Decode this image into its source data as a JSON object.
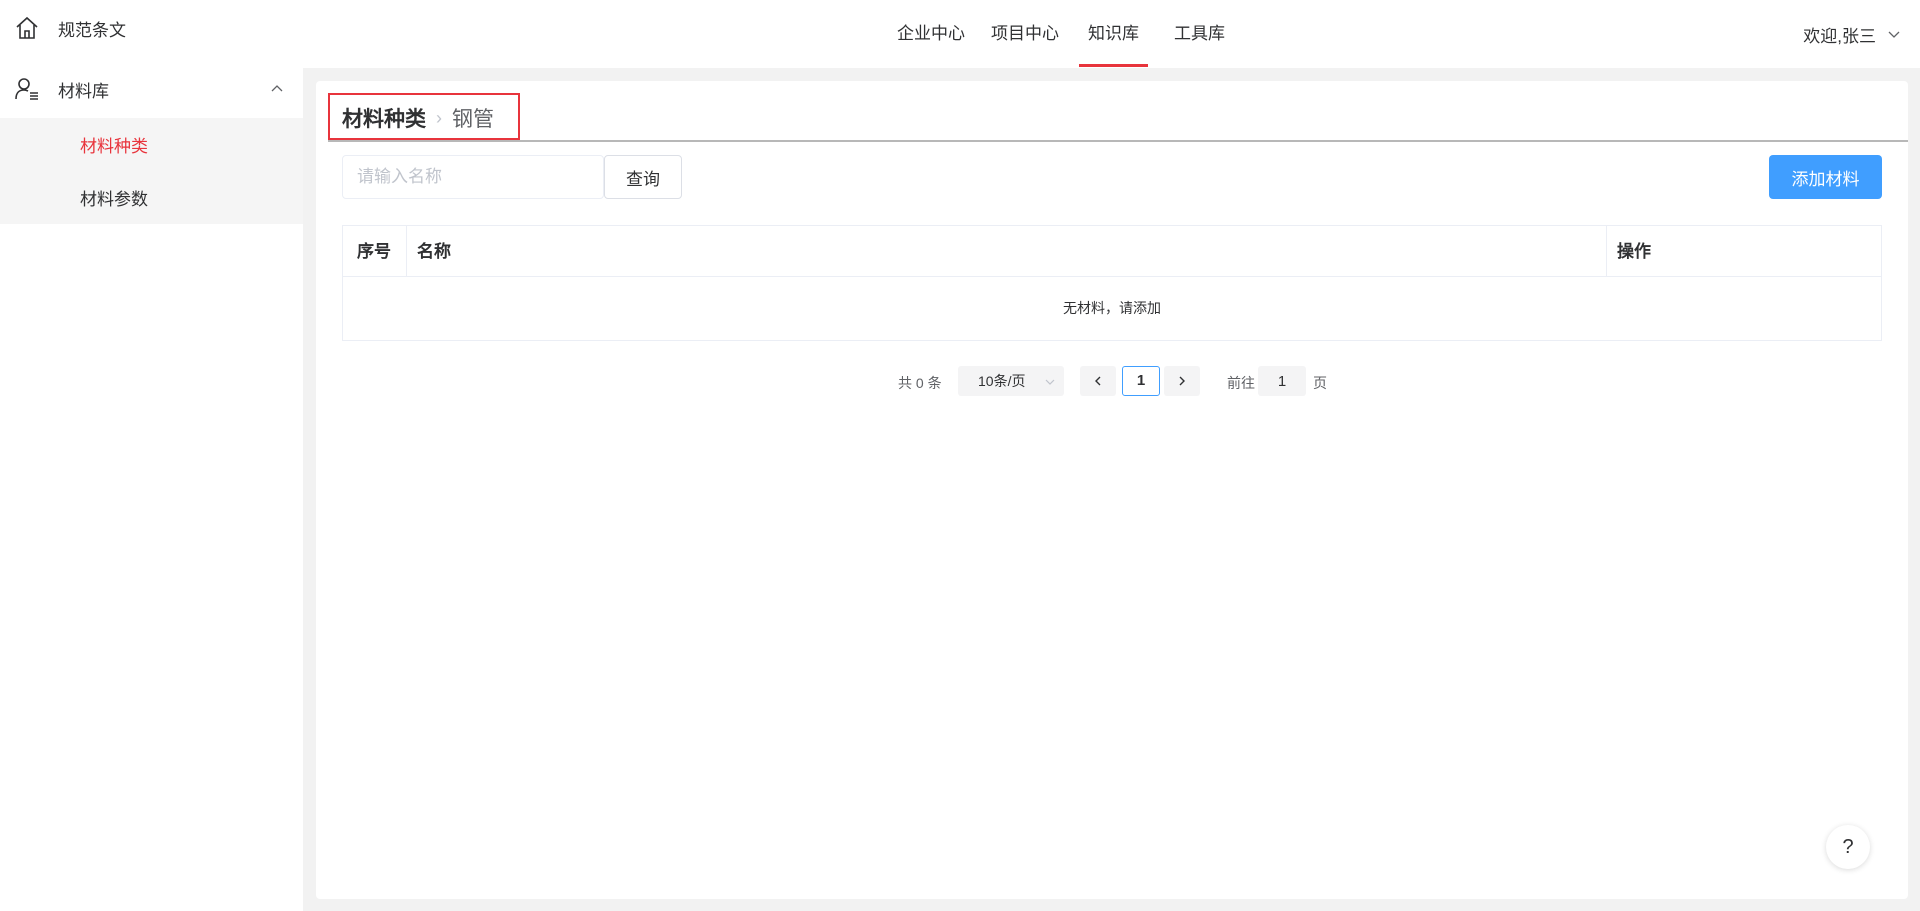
{
  "sidebar": {
    "items": [
      {
        "label": "规范条文",
        "icon": "home-icon"
      },
      {
        "label": "材料库",
        "icon": "user-list-icon",
        "expanded": true
      }
    ],
    "subitems": [
      {
        "label": "材料种类",
        "active": true
      },
      {
        "label": "材料参数",
        "active": false
      }
    ]
  },
  "topnav": {
    "tabs": [
      {
        "label": "企业中心",
        "active": false
      },
      {
        "label": "项目中心",
        "active": false
      },
      {
        "label": "知识库",
        "active": true
      },
      {
        "label": "工具库",
        "active": false
      }
    ],
    "welcome": "欢迎,张三"
  },
  "breadcrumb": {
    "root": "材料种类",
    "separator": "›",
    "leaf": "钢管"
  },
  "toolbar": {
    "search_placeholder": "请输入名称",
    "search_value": "",
    "query_label": "查询",
    "add_label": "添加材料"
  },
  "table": {
    "headers": [
      "序号",
      "名称",
      "操作"
    ],
    "empty_text": "无材料，请添加"
  },
  "pagination": {
    "total": "共 0 条",
    "page_size": "10条/页",
    "current": "1",
    "goto_label": "前往",
    "goto_value": "1",
    "page_suffix": "页"
  },
  "help": {
    "label": "?"
  },
  "colors": {
    "accent": "#e8343c",
    "primary": "#409eff"
  }
}
